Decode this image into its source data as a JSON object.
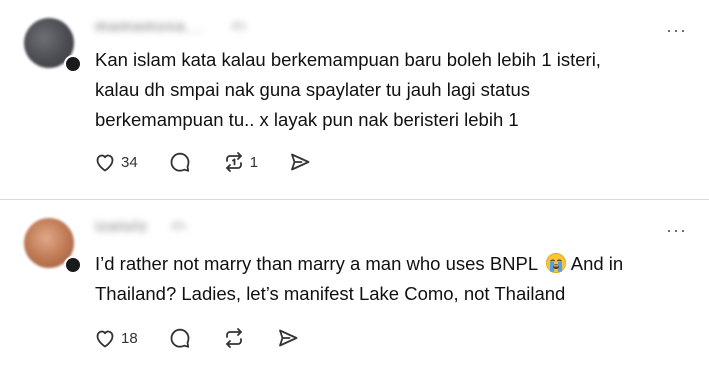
{
  "posts": [
    {
      "username": "mamamusa__",
      "time": "4h",
      "text": "Kan islam kata kalau berkemampuan baru boleh lebih 1 isteri,\nkalau dh smpai nak guna spaylater tu jauh lagi status\nberkemampuan tu.. x layak pun nak beristeri lebih 1",
      "likes": "34",
      "reposts": "1",
      "more": "···"
    },
    {
      "username": "izatulz",
      "time": "4h",
      "text_before": "I’d rather not marry than marry a man who uses BNPL ",
      "text_after": " And in\nThailand? Ladies, let’s manifest Lake Como, not Thailand",
      "emoji": "loudly-crying-face-icon",
      "likes": "18",
      "more": "···"
    }
  ]
}
